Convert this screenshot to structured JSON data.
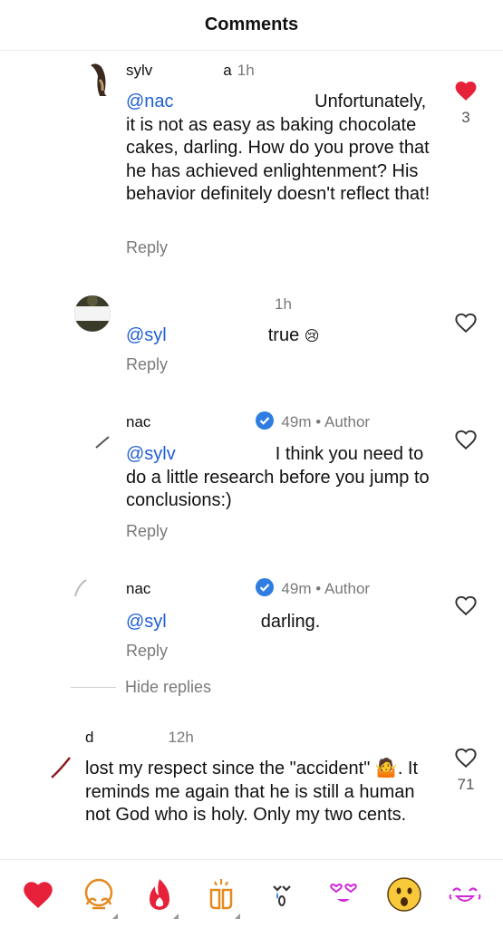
{
  "header": {
    "title": "Comments"
  },
  "comments": [
    {
      "user": "sylv",
      "user_tail": "a",
      "time": "1h",
      "mention": "@nac",
      "text": " Unfortunately, it is not as easy as baking chocolate cakes, darling. How do you prove that he has achieved enlightenment? His behavior definitely doesn't reflect that!",
      "reply": "Reply",
      "liked": true,
      "likes": "3"
    },
    {
      "user": "",
      "time": "1h",
      "mention": "@syl",
      "text": "true",
      "reply": "Reply",
      "liked": false,
      "likes": ""
    },
    {
      "user": "nac",
      "time": "49m",
      "author": "Author",
      "mention": "@sylv",
      "text": "I think you need to do a little research before you jump to conclusions:)",
      "reply": "Reply",
      "liked": false,
      "likes": ""
    },
    {
      "user": "nac",
      "time": "49m",
      "author": "Author",
      "mention": "@syl",
      "text": "darling.",
      "reply": "Reply",
      "liked": false,
      "likes": ""
    },
    {
      "user": "d",
      "time": "12h",
      "text_a": "lost my respect since the \"accident\"",
      "text_b": ". It reminds me again that he is still a human not God who is holy. Only my two cents.",
      "liked": false,
      "likes": "71"
    }
  ],
  "hide_replies": "Hide replies",
  "separator": "•",
  "reactions": [
    {
      "name": "heart-emoji",
      "glyph": "❤️"
    },
    {
      "name": "hands-over-face-emoji",
      "glyph": "🙌"
    },
    {
      "name": "fire-emoji",
      "glyph": "🔥"
    },
    {
      "name": "clapping-emoji",
      "glyph": "👏"
    },
    {
      "name": "crying-emoji",
      "glyph": "😢"
    },
    {
      "name": "heart-eyes-emoji",
      "glyph": "😍"
    },
    {
      "name": "surprised-emoji",
      "glyph": "😮"
    },
    {
      "name": "laughing-emoji",
      "glyph": "😂"
    }
  ],
  "colors": {
    "accent": "#1f5fd1",
    "like_red": "#e8213b",
    "muted": "#7a7a7a"
  }
}
